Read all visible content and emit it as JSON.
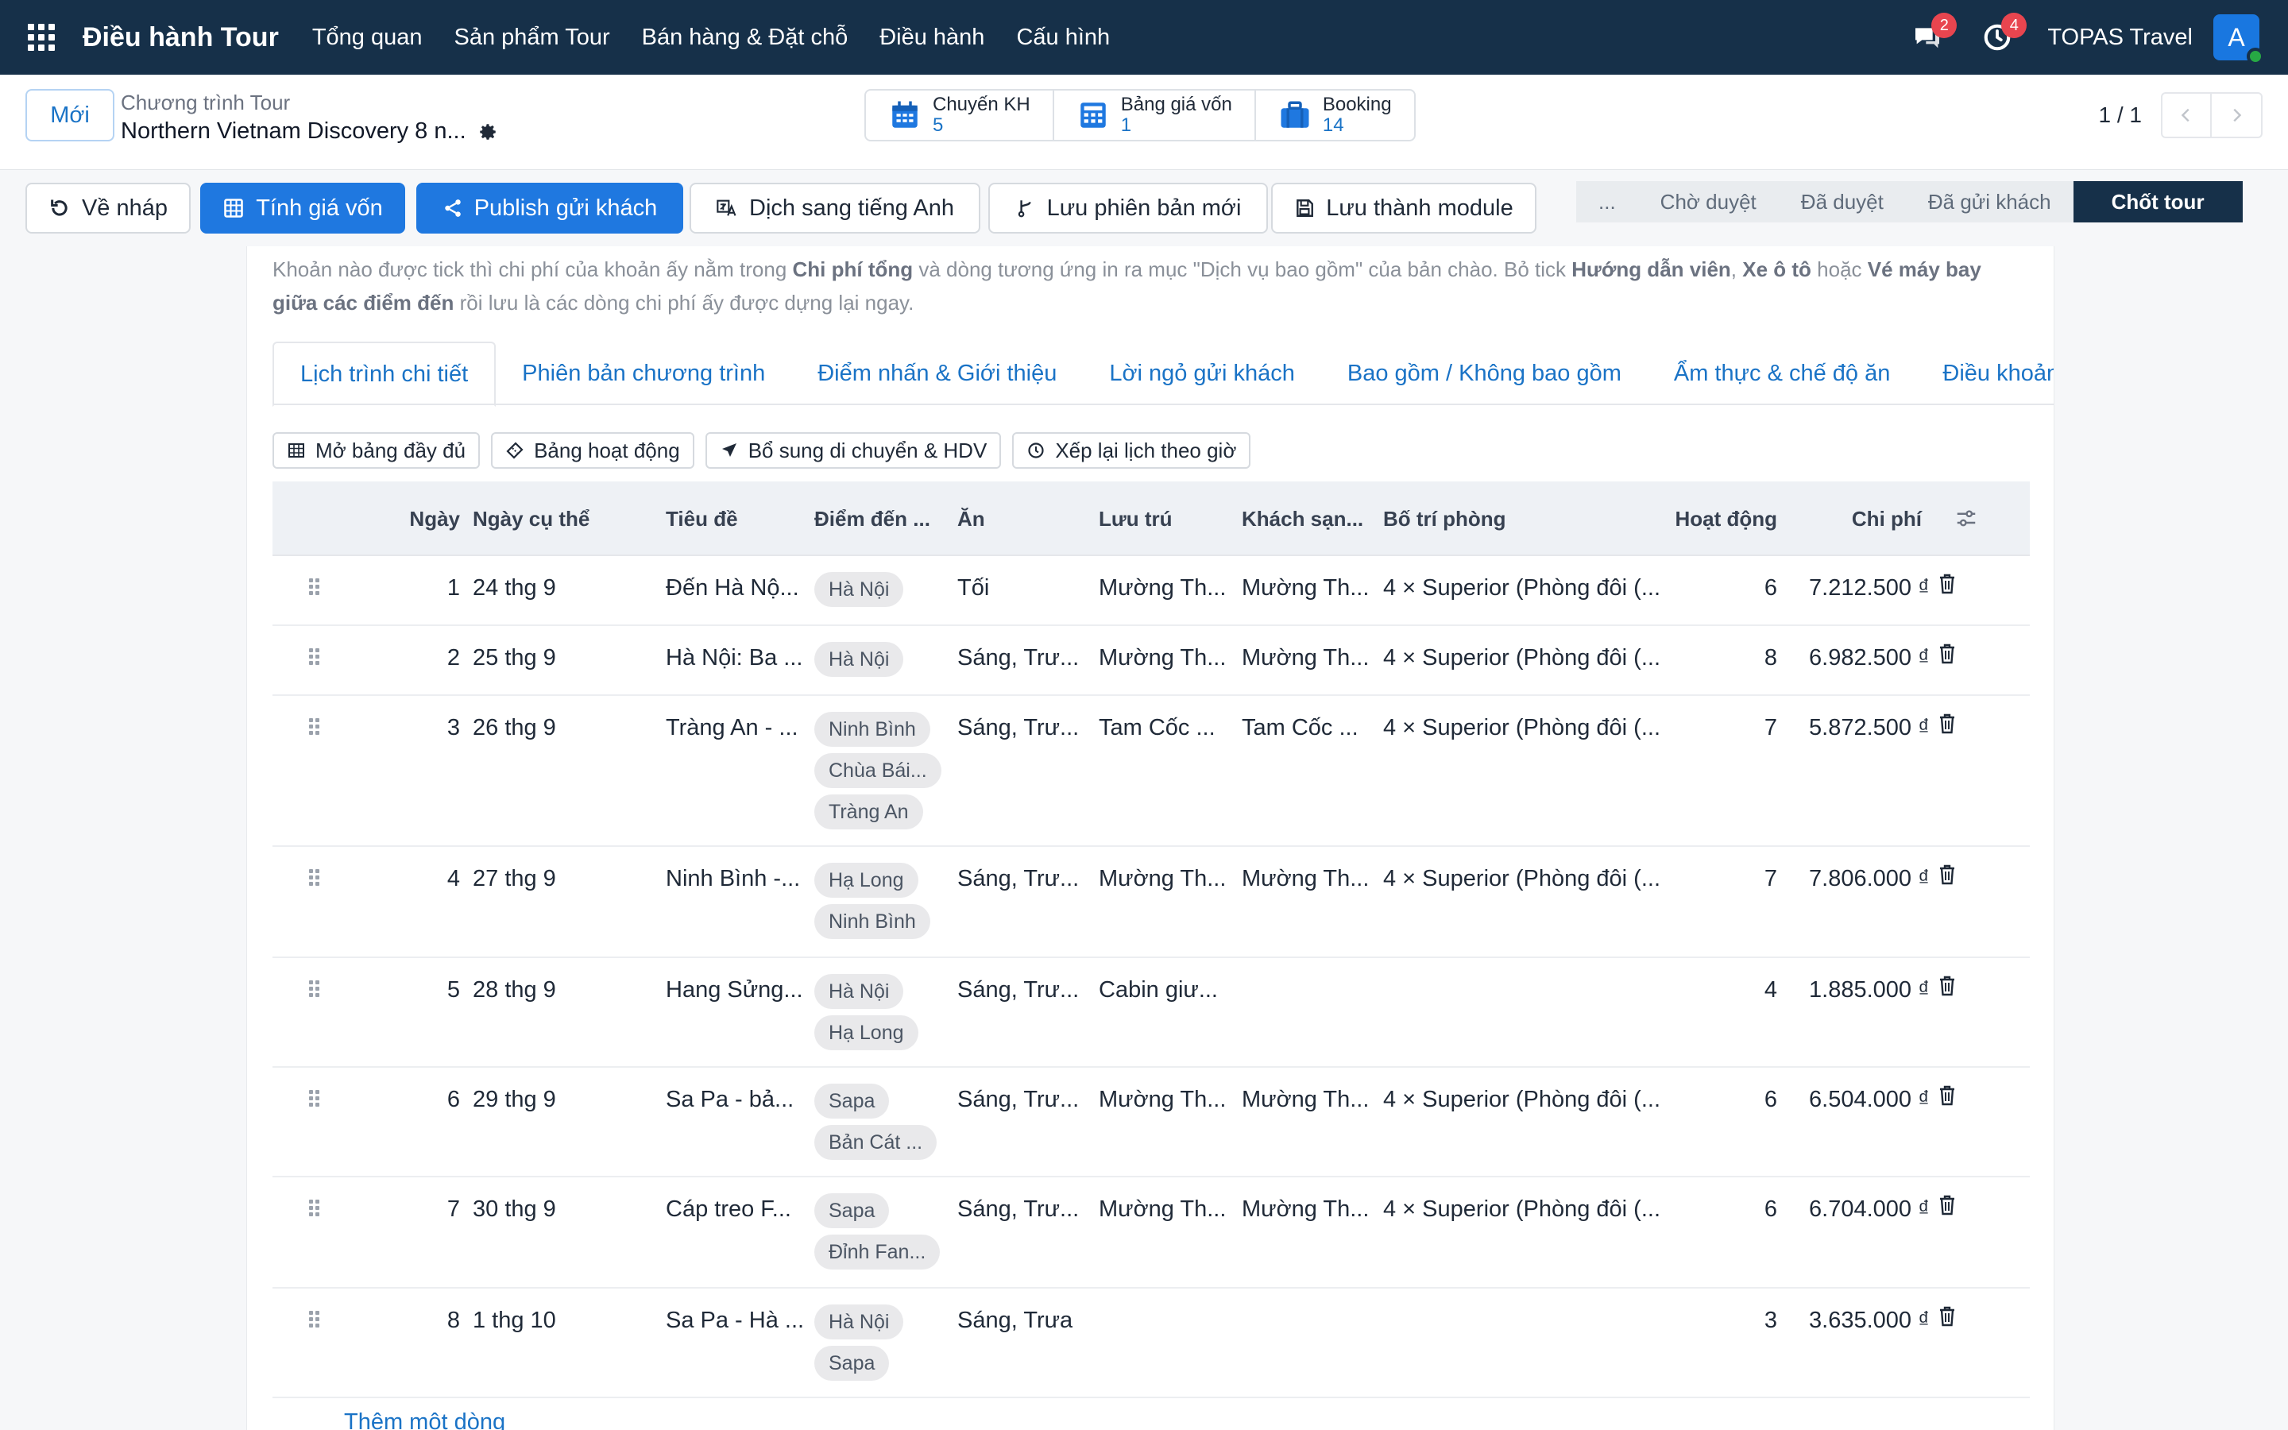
{
  "navbar": {
    "brand": "Điều hành Tour",
    "menu": [
      "Tổng quan",
      "Sản phẩm Tour",
      "Bán hàng & Đặt chỗ",
      "Điều hành",
      "Cấu hình"
    ],
    "messages_count": "2",
    "activities_count": "4",
    "company": "TOPAS Travel",
    "avatar_initial": "A"
  },
  "control": {
    "new_label": "Mới",
    "breadcrumb_parent": "Chương trình Tour",
    "record_title": "Northern Vietnam Discovery 8 n...",
    "smart_buttons": [
      {
        "label": "Chuyến KH",
        "value": "5",
        "icon": "calendar-icon"
      },
      {
        "label": "Bảng giá vốn",
        "value": "1",
        "icon": "calculator-icon"
      },
      {
        "label": "Booking",
        "value": "14",
        "icon": "suitcase-icon"
      }
    ],
    "pager": "1 / 1"
  },
  "actions": {
    "reset_draft": "Về nháp",
    "compute_cost": "Tính giá vốn",
    "publish": "Publish gửi khách",
    "translate": "Dịch sang tiếng Anh",
    "save_version": "Lưu phiên bản mới",
    "save_module": "Lưu thành module"
  },
  "statusbar": {
    "more": "...",
    "stages": [
      "Chờ duyệt",
      "Đã duyệt",
      "Đã gửi khách",
      "Chốt tour"
    ],
    "active": "Chốt tour"
  },
  "hint": {
    "line1_a": "Khoản nào được tick thì chi phí của khoản ấy nằm trong ",
    "line1_b": "Chi phí tổng",
    "line1_c": " và dòng tương ứng in ra mục \"Dịch vụ bao gồm\" của bản chào. Bỏ tick ",
    "line1_d": "Hướng dẫn viên",
    "line1_e": ", ",
    "line1_f": "Xe ô tô",
    "line1_g": " hoặc ",
    "line1_h": "Vé máy bay giữa các điểm đến",
    "line1_i": " rồi lưu là các dòng chi phí ấy được dựng lại ngay."
  },
  "tabs": [
    "Lịch trình chi tiết",
    "Phiên bản chương trình",
    "Điểm nhấn & Giới thiệu",
    "Lời ngỏ gửi khách",
    "Bao gồm / Không bao gồm",
    "Ẩm thực & chế độ ăn",
    "Điều khoản ("
  ],
  "tools": [
    "Mở bảng đầy đủ",
    "Bảng hoạt động",
    "Bổ sung di chuyển & HDV",
    "Xếp lại lịch theo giờ"
  ],
  "table": {
    "headers": {
      "day": "Ngày",
      "date": "Ngày cụ thể",
      "title": "Tiêu đề",
      "destinations": "Điểm đến ...",
      "meals": "Ăn",
      "stay": "Lưu trú",
      "hotel": "Khách sạn...",
      "rooms": "Bố trí phòng",
      "activities": "Hoạt động",
      "cost": "Chi phí"
    },
    "rows": [
      {
        "day": "1",
        "date": "24 thg 9",
        "title": "Đến Hà Nộ...",
        "tags": [
          "Hà Nội"
        ],
        "meals": "Tối",
        "stay": "Mường Th...",
        "hotel": "Mường Th...",
        "rooms": "4 × Superior (Phòng đôi (...",
        "activities": "6",
        "cost": "7.212.500 ₫"
      },
      {
        "day": "2",
        "date": "25 thg 9",
        "title": "Hà Nội: Ba ...",
        "tags": [
          "Hà Nội"
        ],
        "meals": "Sáng, Trư...",
        "stay": "Mường Th...",
        "hotel": "Mường Th...",
        "rooms": "4 × Superior (Phòng đôi (...",
        "activities": "8",
        "cost": "6.982.500 ₫"
      },
      {
        "day": "3",
        "date": "26 thg 9",
        "title": "Tràng An - ...",
        "tags": [
          "Ninh Bình",
          "Chùa Bái...",
          "Tràng An"
        ],
        "meals": "Sáng, Trư...",
        "stay": "Tam Cốc ...",
        "hotel": "Tam Cốc ...",
        "rooms": "4 × Superior (Phòng đôi (...",
        "activities": "7",
        "cost": "5.872.500 ₫"
      },
      {
        "day": "4",
        "date": "27 thg 9",
        "title": "Ninh Bình -...",
        "tags": [
          "Hạ Long",
          "Ninh Bình"
        ],
        "meals": "Sáng, Trư...",
        "stay": "Mường Th...",
        "hotel": "Mường Th...",
        "rooms": "4 × Superior (Phòng đôi (...",
        "activities": "7",
        "cost": "7.806.000 ₫"
      },
      {
        "day": "5",
        "date": "28 thg 9",
        "title": "Hang Sửng...",
        "tags": [
          "Hà Nội",
          "Hạ Long"
        ],
        "meals": "Sáng, Trư...",
        "stay": "Cabin giư...",
        "hotel": "",
        "rooms": "",
        "activities": "4",
        "cost": "1.885.000 ₫"
      },
      {
        "day": "6",
        "date": "29 thg 9",
        "title": "Sa Pa - bả...",
        "tags": [
          "Sapa",
          "Bản Cát ..."
        ],
        "meals": "Sáng, Trư...",
        "stay": "Mường Th...",
        "hotel": "Mường Th...",
        "rooms": "4 × Superior (Phòng đôi (...",
        "activities": "6",
        "cost": "6.504.000 ₫"
      },
      {
        "day": "7",
        "date": "30 thg 9",
        "title": "Cáp treo F...",
        "tags": [
          "Sapa",
          "Đỉnh Fan..."
        ],
        "meals": "Sáng, Trư...",
        "stay": "Mường Th...",
        "hotel": "Mường Th...",
        "rooms": "4 × Superior (Phòng đôi (...",
        "activities": "6",
        "cost": "6.704.000 ₫"
      },
      {
        "day": "8",
        "date": "1 thg 10",
        "title": "Sa Pa - Hà ...",
        "tags": [
          "Hà Nội",
          "Sapa"
        ],
        "meals": "Sáng, Trưa",
        "stay": "",
        "hotel": "",
        "rooms": "",
        "activities": "3",
        "cost": "3.635.000 ₫"
      }
    ],
    "add_line": "Thêm một dòng"
  }
}
